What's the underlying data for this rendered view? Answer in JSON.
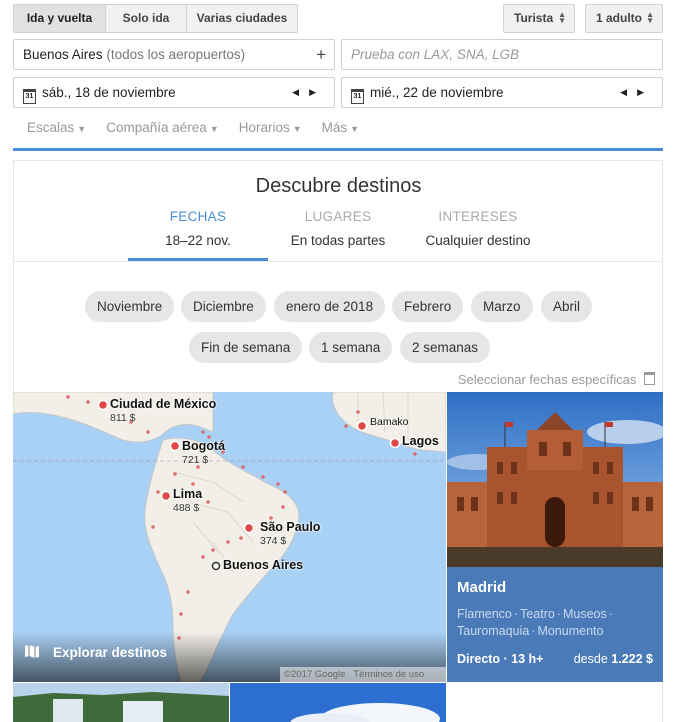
{
  "trip_types": [
    "Ida y vuelta",
    "Solo ida",
    "Varias ciudades"
  ],
  "cabin": "Turista",
  "passengers": "1 adulto",
  "origin": {
    "city": "Buenos Aires",
    "detail": "(todos los aeropuertos)"
  },
  "destination_placeholder": "Prueba con LAX, SNA, LGB",
  "depart_date": "sáb., 18 de noviembre",
  "return_date": "mié., 22 de noviembre",
  "calendar_digit": "31",
  "filters": [
    "Escalas",
    "Compañía aérea",
    "Horarios",
    "Más"
  ],
  "title": "Descubre destinos",
  "tabs": [
    {
      "title": "FECHAS",
      "sub": "18–22 nov."
    },
    {
      "title": "LUGARES",
      "sub": "En todas partes"
    },
    {
      "title": "INTERESES",
      "sub": "Cualquier destino"
    }
  ],
  "chips_row1": [
    "Noviembre",
    "Diciembre",
    "enero de 2018",
    "Febrero",
    "Marzo",
    "Abril"
  ],
  "chips_row2": [
    "Fin de semana",
    "1 semana",
    "2 semanas"
  ],
  "specific_dates": "Seleccionar fechas específicas",
  "map": {
    "cities": [
      {
        "name": "Ciudad de México",
        "price": "811 $"
      },
      {
        "name": "Bogotá",
        "price": "721 $"
      },
      {
        "name": "Lima",
        "price": "488 $"
      },
      {
        "name": "São Paulo",
        "price": "374 $"
      },
      {
        "name": "Buenos Aires",
        "price": ""
      },
      {
        "name": "Bamako",
        "price": ""
      },
      {
        "name": "Lagos",
        "price": ""
      }
    ],
    "explore_label": "Explorar destinos",
    "copyright": "©2017 Google",
    "terms": "Términos de uso"
  },
  "featured": {
    "name": "Madrid",
    "tags": [
      "Flamenco",
      "Teatro",
      "Museos",
      "Tauromaquia",
      "Monumento"
    ],
    "direct": "Directo · 13 h+",
    "price_prefix": "desde",
    "price": "1.222 $"
  },
  "colors": {
    "accent": "#4a8ed8",
    "map_sea": "#a9d0f5",
    "featured_bg": "#4a7bb8"
  }
}
